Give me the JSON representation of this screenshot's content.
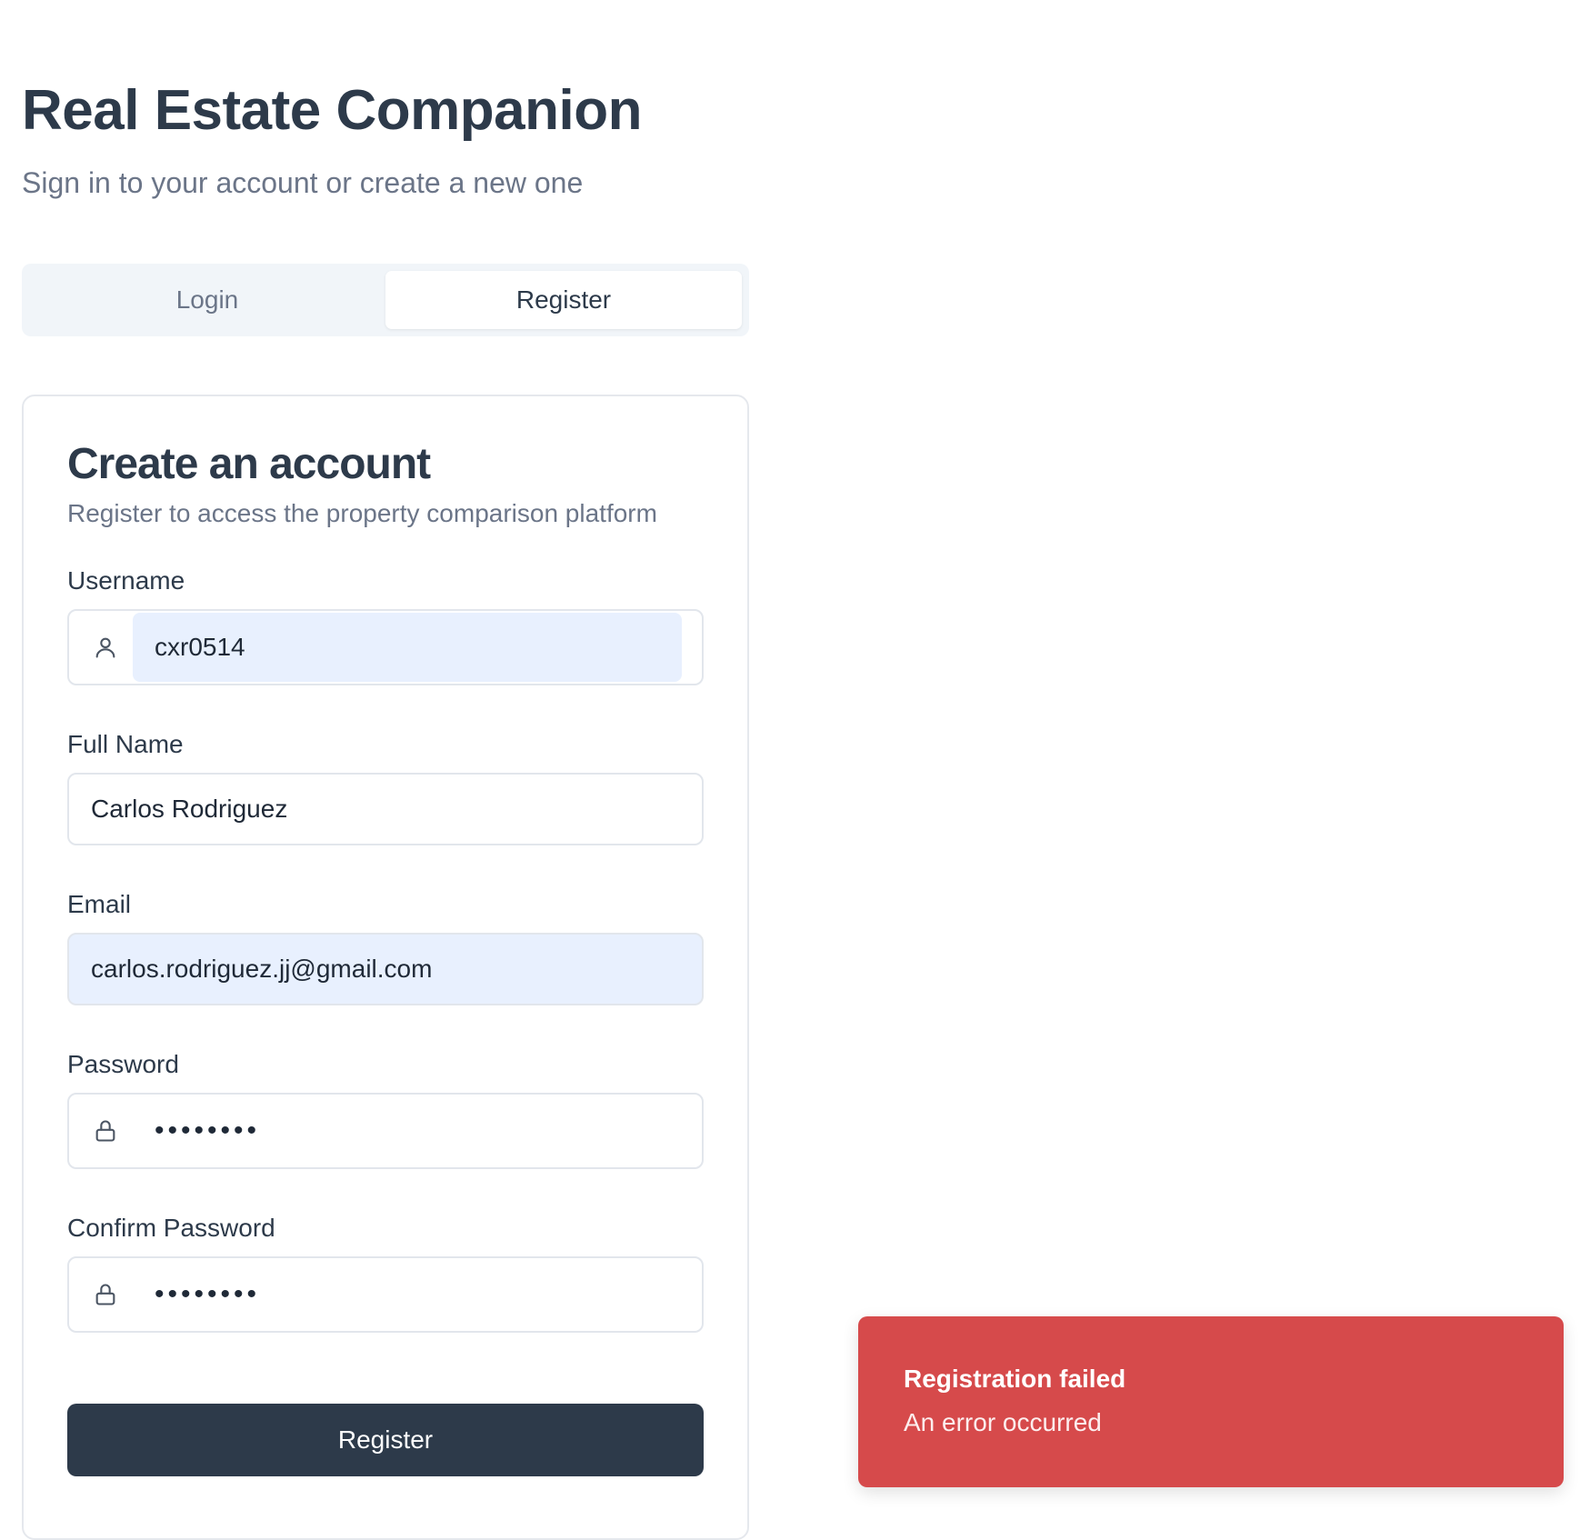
{
  "header": {
    "title": "Real Estate Companion",
    "subtitle": "Sign in to your account or create a new one"
  },
  "tabs": [
    {
      "label": "Login",
      "active": false
    },
    {
      "label": "Register",
      "active": true
    }
  ],
  "card": {
    "title": "Create an account",
    "description": "Register to access the property comparison platform"
  },
  "form": {
    "username": {
      "label": "Username",
      "value": "cxr0514",
      "icon": "user-icon"
    },
    "full_name": {
      "label": "Full Name",
      "value": "Carlos Rodriguez"
    },
    "email": {
      "label": "Email",
      "value": "carlos.rodriguez.jj@gmail.com"
    },
    "password": {
      "label": "Password",
      "value": "••••••••",
      "icon": "lock-icon"
    },
    "confirm_password": {
      "label": "Confirm Password",
      "value": "••••••••",
      "icon": "lock-icon"
    },
    "submit_label": "Register"
  },
  "toast": {
    "title": "Registration failed",
    "message": "An error occurred",
    "color": "#d64a4b"
  },
  "colors": {
    "primary": "#2d3a4a",
    "muted": "#6b7588",
    "autofill": "#e8f0fe"
  }
}
